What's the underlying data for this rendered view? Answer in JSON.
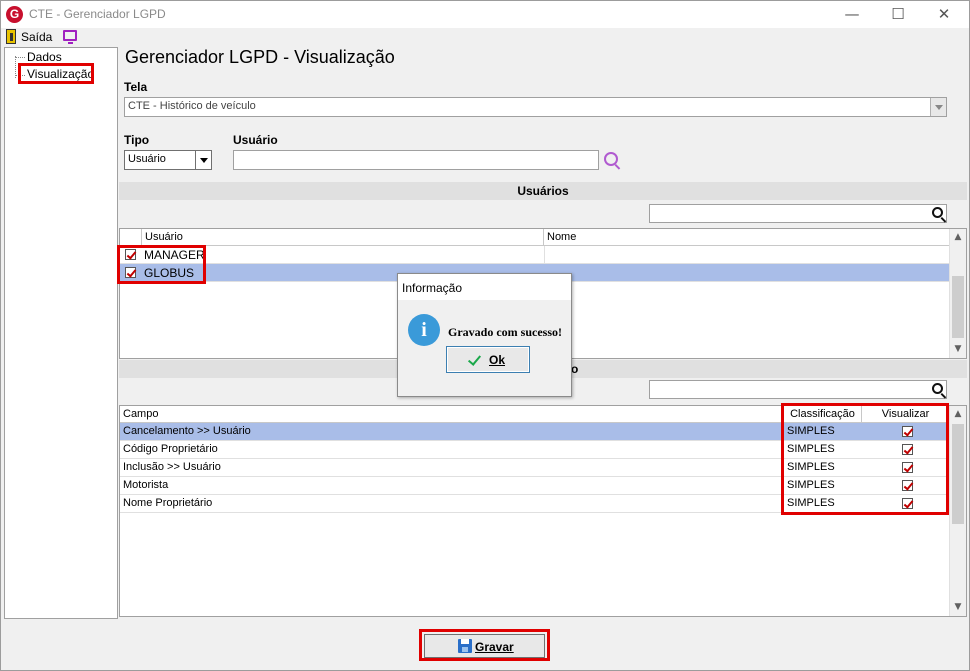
{
  "window": {
    "title": "CTE - Gerenciador LGPD",
    "minimize_icon": "minimize-icon",
    "maximize_icon": "maximize-icon",
    "close_icon": "close-icon"
  },
  "menu": {
    "exit_label": "Saída"
  },
  "sidebar": {
    "items": [
      {
        "label": "Dados"
      },
      {
        "label": "Visualização"
      }
    ]
  },
  "main": {
    "title": "Gerenciador LGPD - Visualização",
    "tela_label": "Tela",
    "tela_value": "CTE - Histórico de veículo",
    "tipo_label": "Tipo",
    "tipo_value": "Usuário",
    "usuario_label": "Usuário",
    "usuario_value": ""
  },
  "users_section": {
    "title": "Usuários",
    "columns": [
      "Usuário",
      "Nome"
    ],
    "rows": [
      {
        "usuario": "MANAGER",
        "nome": "",
        "checked": true,
        "selected": false
      },
      {
        "usuario": "GLOBUS",
        "nome": "",
        "checked": true,
        "selected": true
      }
    ]
  },
  "fields_section": {
    "title_visible_tail": "o",
    "columns": [
      "Campo",
      "Classificação",
      "Visualizar"
    ],
    "rows": [
      {
        "campo": "Cancelamento >> Usuário",
        "classificacao": "SIMPLES",
        "visualizar": true,
        "selected": true
      },
      {
        "campo": "Código Proprietário",
        "classificacao": "SIMPLES",
        "visualizar": true,
        "selected": false
      },
      {
        "campo": "Inclusão >> Usuário",
        "classificacao": "SIMPLES",
        "visualizar": true,
        "selected": false
      },
      {
        "campo": "Motorista",
        "classificacao": "SIMPLES",
        "visualizar": true,
        "selected": false
      },
      {
        "campo": "Nome Proprietário",
        "classificacao": "SIMPLES",
        "visualizar": true,
        "selected": false
      }
    ]
  },
  "dialog": {
    "title": "Informação",
    "message": "Gravado com sucesso!",
    "ok_label": "Ok"
  },
  "footer": {
    "save_label": "Gravar"
  },
  "colors": {
    "highlight": "#e00000",
    "selection": "#a9bde8",
    "check": "#c00000"
  }
}
